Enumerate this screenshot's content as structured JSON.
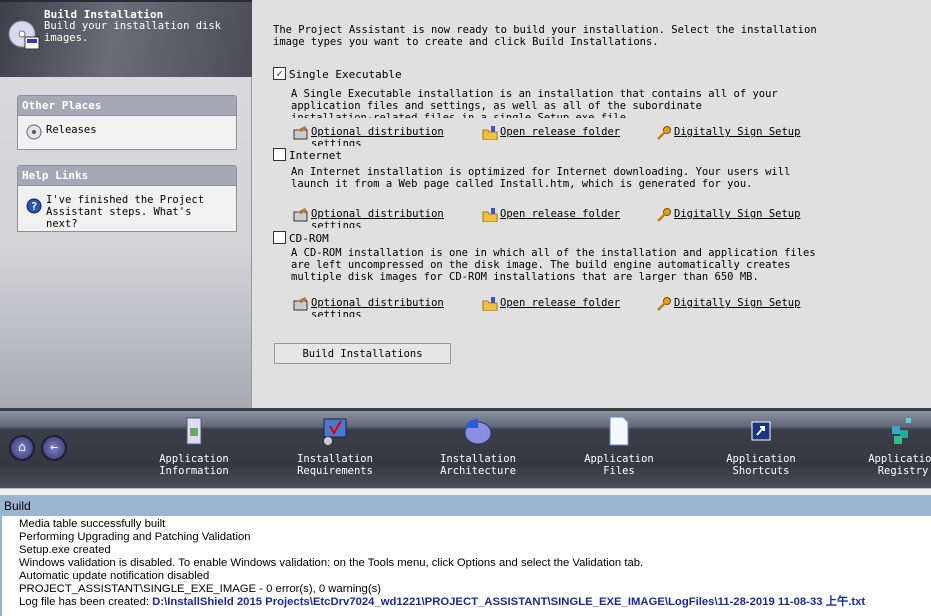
{
  "header": {
    "title": "Build Installation",
    "subtitle": "Build your installation disk images.",
    "icon": "cd-build-icon"
  },
  "other_places": {
    "title": "Other Places",
    "items": [
      {
        "label": "Releases",
        "icon": "cd-icon"
      }
    ]
  },
  "help_links": {
    "title": "Help Links",
    "items": [
      {
        "label": "I've finished the Project Assistant steps. What's next?",
        "icon": "help-icon"
      }
    ]
  },
  "intro": "The Project Assistant is now ready to build your installation. Select the installation\nimage types you want to create and click Build Installations.",
  "options": [
    {
      "label": "Single Executable",
      "checked": true,
      "description": "A Single Executable installation is an installation that contains all of your\napplication files and settings, as well as all of the subordinate\ninstallation-related files in a single Setup.exe file."
    },
    {
      "label": "Internet",
      "checked": false,
      "description": "An Internet installation is optimized for Internet downloading. Your users will\nlaunch it from a Web page called Install.htm, which is generated for you."
    },
    {
      "label": "CD-ROM",
      "checked": false,
      "description": "A CD-ROM installation is one in which all of the installation and application files\nare left uncompressed on the disk image. The build engine automatically creates\nmultiple disk images for CD-ROM installations that are larger than 650 MB."
    }
  ],
  "links": {
    "distribution": "Optional distribution settings",
    "release_folder": "Open release folder",
    "sign": "Digitally Sign Setup"
  },
  "build_button": "Build Installations",
  "nav": [
    {
      "label": "Application\nInformation",
      "icon": "app-info-icon"
    },
    {
      "label": "Installation\nRequirements",
      "icon": "requirements-icon"
    },
    {
      "label": "Installation\nArchitecture",
      "icon": "architecture-icon"
    },
    {
      "label": "Application\nFiles",
      "icon": "file-icon"
    },
    {
      "label": "Application\nShortcuts",
      "icon": "shortcut-icon"
    },
    {
      "label": "Application\nRegistry",
      "icon": "registry-icon"
    }
  ],
  "output": {
    "title": "Build",
    "lines": [
      "Media table successfully built",
      "Performing Upgrading and Patching Validation",
      "Setup.exe created",
      "Windows validation is disabled. To enable Windows validation: on the Tools menu, click Options and select the Validation tab.",
      "Automatic update notification disabled",
      "PROJECT_ASSISTANT\\SINGLE_EXE_IMAGE - 0 error(s), 0 warning(s)"
    ],
    "last_prefix": "Log file has been created: ",
    "last_path": "D:\\InstallShield 2015 Projects\\EtcDrv7024_wd1221\\PROJECT_ASSISTANT\\SINGLE_EXE_IMAGE\\LogFiles\\11-28-2019 11-08-33 上午.txt"
  },
  "colors": {
    "output_header": "#9bb4d0",
    "link_path": "#1a2a9a"
  }
}
